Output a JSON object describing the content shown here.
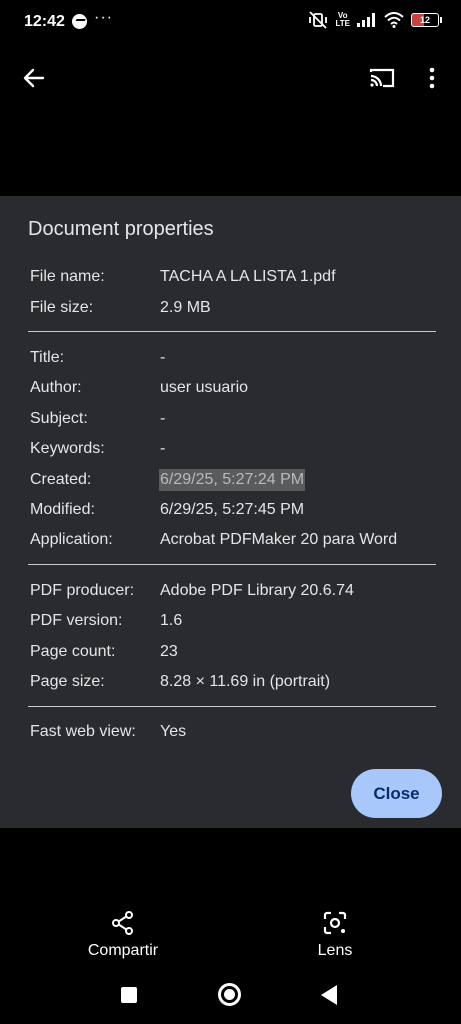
{
  "status_bar": {
    "time": "12:42",
    "overflow": "···",
    "volte_top": "Vo",
    "volte_bottom": "LTE",
    "battery": "12",
    "icons": [
      "messenger-icon",
      "mute-vibrate-icon",
      "signal-icon",
      "wifi-icon",
      "battery-icon"
    ]
  },
  "app_bar": {
    "icons": [
      "back-arrow-icon",
      "cast-icon",
      "more-vert-icon"
    ]
  },
  "dialog": {
    "title": "Document properties",
    "rows": [
      {
        "label": "File name:",
        "value": "TACHA A LA LISTA 1.pdf"
      },
      {
        "label": "File size:",
        "value": "2.9 MB"
      },
      {
        "label": "Title:",
        "value": "-"
      },
      {
        "label": "Author:",
        "value": "user usuario"
      },
      {
        "label": "Subject:",
        "value": "-"
      },
      {
        "label": "Keywords:",
        "value": "-"
      },
      {
        "label": "Created:",
        "value": "6/29/25, 5:27:24 PM"
      },
      {
        "label": "Modified:",
        "value": "6/29/25, 5:27:45 PM"
      },
      {
        "label": "Application:",
        "value": "Acrobat PDFMaker 20 para Word"
      },
      {
        "label": "PDF producer:",
        "value": "Adobe PDF Library 20.6.74"
      },
      {
        "label": "PDF version:",
        "value": "1.6"
      },
      {
        "label": "Page count:",
        "value": "23"
      },
      {
        "label": "Page size:",
        "value": "8.28 × 11.69 in (portrait)"
      },
      {
        "label": "Fast web view:",
        "value": "Yes"
      }
    ],
    "close_label": "Close"
  },
  "bottom_actions": {
    "share_label": "Compartir",
    "lens_label": "Lens"
  },
  "colors": {
    "dialog_bg": "#2a2b2e",
    "close_button_bg": "#a8c7fa",
    "close_button_text": "#062e6f",
    "highlight_bg": "#5a5b5d"
  }
}
